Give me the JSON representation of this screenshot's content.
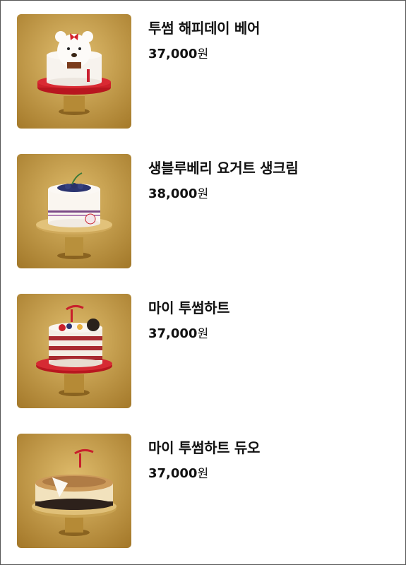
{
  "products": [
    {
      "name": "투썸 해피데이 베어",
      "price": "37,000",
      "currency": "원",
      "image": "bear-cake-image"
    },
    {
      "name": "생블루베리 요거트 생크림",
      "price": "38,000",
      "currency": "원",
      "image": "blueberry-cake-image"
    },
    {
      "name": "마이 투썸하트",
      "price": "37,000",
      "currency": "원",
      "image": "layer-cake-image"
    },
    {
      "name": "마이 투썸하트 듀오",
      "price": "37,000",
      "currency": "원",
      "image": "cheesecake-image"
    }
  ],
  "colors": {
    "gold_background": "#c29a3c",
    "accent_red": "#c8202c"
  }
}
